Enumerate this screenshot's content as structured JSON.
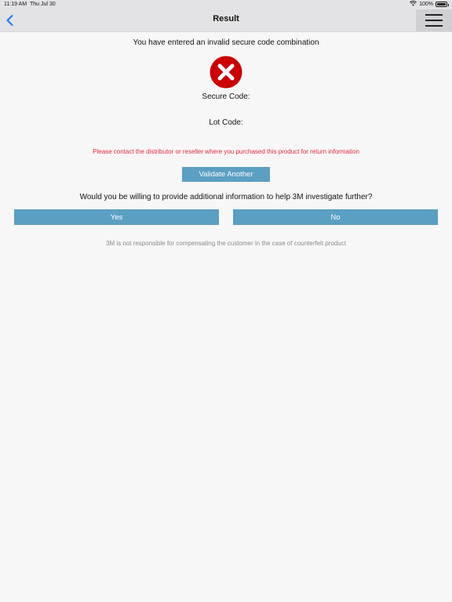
{
  "status_bar": {
    "time": "11:19 AM",
    "date": "Thu Jul 30",
    "battery": "100%",
    "battery_level": 1.0
  },
  "nav": {
    "title": "Result",
    "back_icon": "chevron-left-icon",
    "menu_icon": "hamburger-menu-icon"
  },
  "result": {
    "headline": "You have entered an invalid secure code combination",
    "status_icon": "error-x-icon",
    "secure_code_label": "Secure Code:",
    "lot_code_label": "Lot Code:",
    "contact_message": "Please contact the distributor or reseller where you purchased this product for return information",
    "validate_button": "Validate Another",
    "question": "Would you be willing to provide additional information to help 3M investigate further?",
    "yes_button": "Yes",
    "no_button": "No",
    "disclaimer": "3M is not responsible for compensating the customer in the case of counterfeit product"
  },
  "colors": {
    "accent": "#5b9fc2",
    "error": "#cc0000",
    "warning_text": "#e0283a",
    "back_link": "#1a7cf0"
  }
}
